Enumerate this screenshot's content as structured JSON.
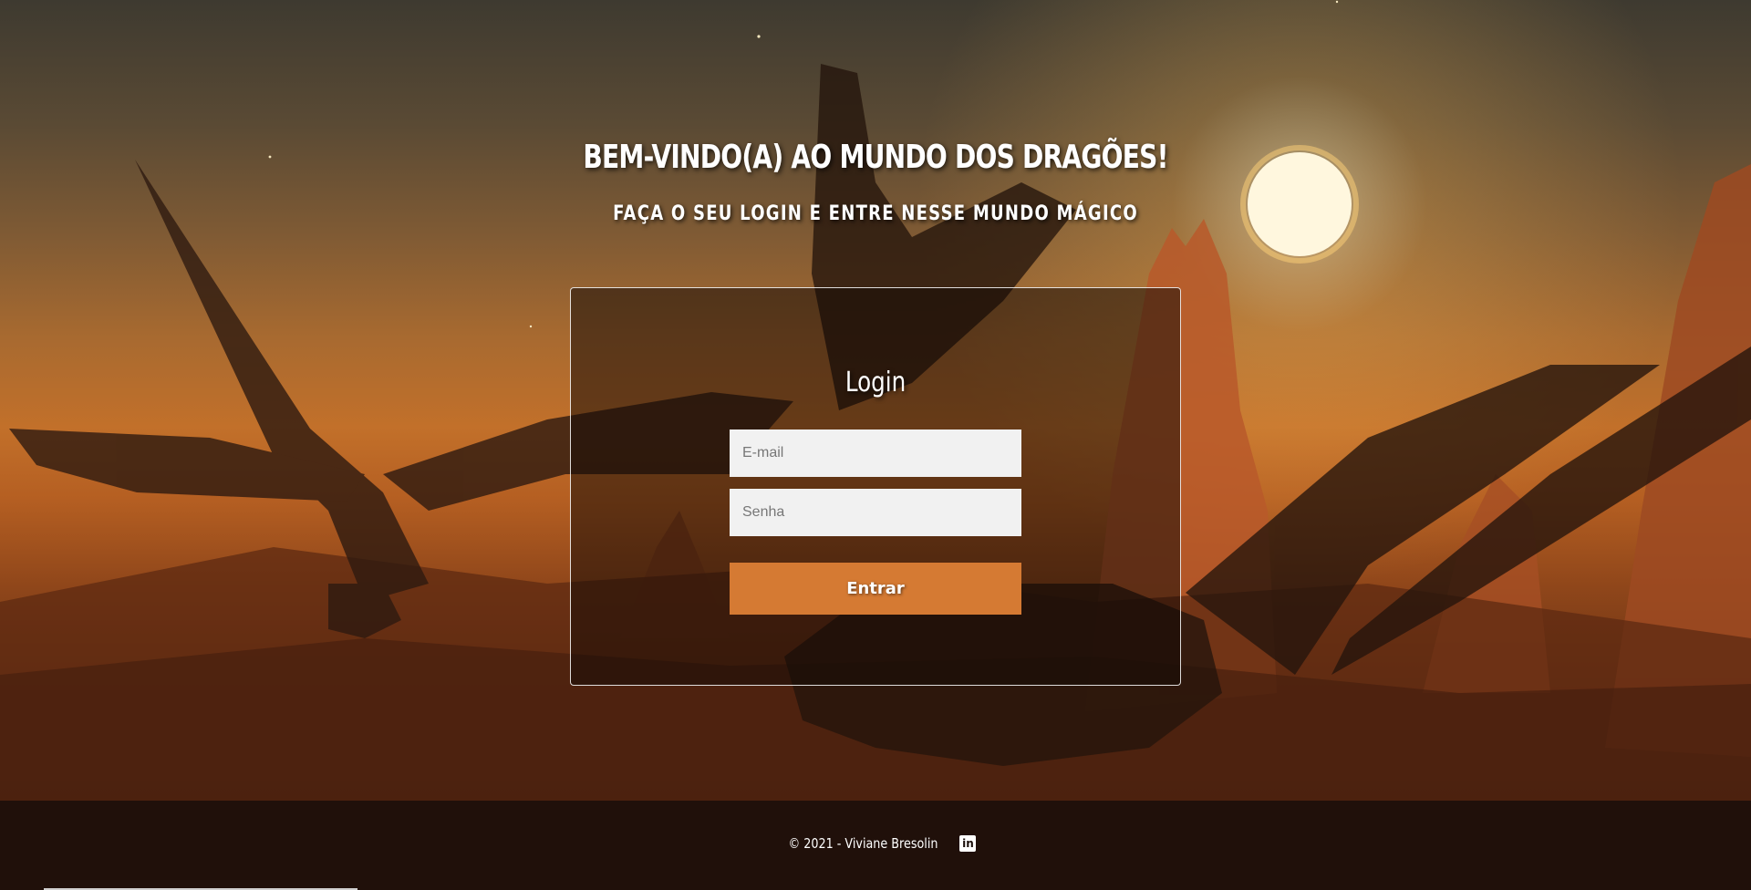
{
  "header": {
    "title": "BEM-VINDO(A) AO MUNDO DOS DRAGÕES!",
    "subtitle": "FAÇA O SEU LOGIN E ENTRE NESSE MUNDO MÁGICO"
  },
  "login": {
    "title": "Login",
    "email_placeholder": "E-mail",
    "password_placeholder": "Senha",
    "submit_label": "Entrar"
  },
  "footer": {
    "copyright": "© 2021 - Viviane Bresolin",
    "social_icon": "linkedin-icon"
  },
  "colors": {
    "accent": "#d57a33",
    "input_bg": "#f1f1f1",
    "footer_bg": "#1a0e0a"
  }
}
